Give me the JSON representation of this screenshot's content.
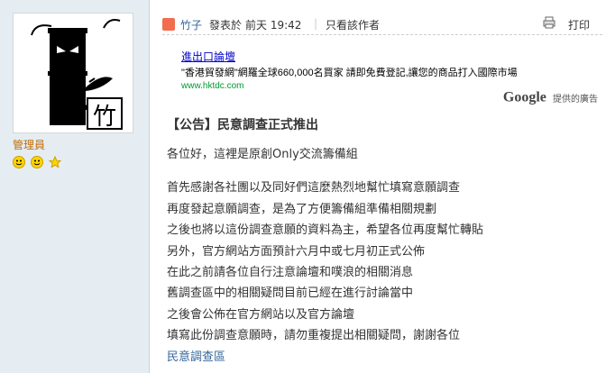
{
  "sidebar": {
    "role": "管理員",
    "medals": [
      "smile-face-icon",
      "smile-face-icon",
      "star-icon"
    ]
  },
  "post_header": {
    "author": "竹子",
    "posted_prefix": "發表於",
    "posted_time": "前天 19:42",
    "separator": "|",
    "only_author": "只看該作者",
    "print_label": "打印"
  },
  "ad": {
    "title": "進出口論壇",
    "description": "\"香港貿發網\"網羅全球660,000名買家 請即免費登記,讓您的商品打入國際市場",
    "url": "www.hktdc.com",
    "google_logo": "Google",
    "google_label": "提供的廣告"
  },
  "post": {
    "title": "【公告】民意調查正式推出",
    "greeting": "各位好，這裡是原創Only交流籌備組",
    "lines": [
      "首先感謝各社團以及同好們這麼熱烈地幫忙填寫意願調查",
      "再度發起意願調查，是為了方便籌備組準備相關規劃",
      "之後也將以這份調查意願的資料為主，希望各位再度幫忙轉貼",
      "另外，官方網站方面預計六月中或七月初正式公佈",
      "在此之前請各位自行注意論壇和噗浪的相關消息",
      "舊調查區中的相關疑問目前已經在進行討論當中",
      "之後會公佈在官方網站以及官方論壇",
      "填寫此份調查意願時，請勿重複提出相關疑問，謝謝各位"
    ],
    "link_text": "民意調查區"
  },
  "colors": {
    "sidebar_bg": "#e5edf2",
    "link": "#336699",
    "role": "#c36b08",
    "ad_title": "#0000cc",
    "ad_url": "#009933"
  }
}
